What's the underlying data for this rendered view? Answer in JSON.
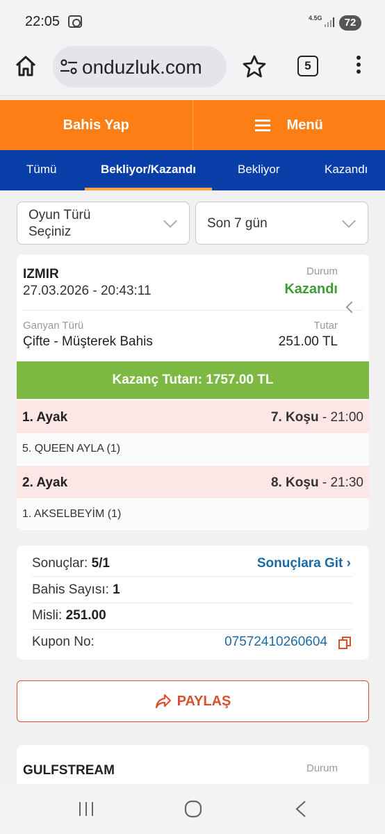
{
  "status_bar": {
    "time": "22:05",
    "network": "4.5G",
    "battery": "72"
  },
  "browser": {
    "url": "onduzluk.com",
    "tab_count": "5"
  },
  "top_nav": {
    "bet_label": "Bahis Yap",
    "menu_label": "Menü"
  },
  "tabs": [
    {
      "label": "Tümü"
    },
    {
      "label": "Bekliyor/Kazandı"
    },
    {
      "label": "Bekliyor"
    },
    {
      "label": "Kazandı"
    }
  ],
  "filters": {
    "game_type_line1": "Oyun Türü",
    "game_type_line2": "Seçiniz",
    "period": "Son 7 gün"
  },
  "bet_card": {
    "venue": "IZMIR",
    "datetime": "27.03.2026 - 20:43:11",
    "status_label": "Durum",
    "status_value": "Kazandı",
    "bet_type_label": "Ganyan Türü",
    "bet_type_value": "Çifte - Müşterek Bahis",
    "amount_label": "Tutar",
    "amount_value": "251.00 TL",
    "winnings": "Kazanç Tutarı: 1757.00 TL",
    "legs": [
      {
        "leg": "1. Ayak",
        "race": "7. Koşu",
        "time": "- 21:00",
        "horse": "5. QUEEN AYLA (1)"
      },
      {
        "leg": "2. Ayak",
        "race": "8. Koşu",
        "time": "- 21:30",
        "horse": "1. AKSELBEYİM (1)"
      }
    ]
  },
  "summary": {
    "results_label": "Sonuçlar:",
    "results_value": "5/1",
    "results_link": "Sonuçlara Git",
    "bet_count_label": "Bahis Sayısı:",
    "bet_count_value": "1",
    "multiplier_label": "Misli:",
    "multiplier_value": "251.00",
    "coupon_label": "Kupon No:",
    "coupon_value": "07572410260604"
  },
  "share_label": "PAYLAŞ",
  "next_card": {
    "venue": "GULFSTREAM",
    "status_label": "Durum"
  },
  "colors": {
    "orange": "#fd7e14",
    "blue": "#0a3ea8",
    "green": "#7cb842",
    "share": "#d9522d",
    "link": "#1a6aa6",
    "won": "#3f9a37"
  }
}
